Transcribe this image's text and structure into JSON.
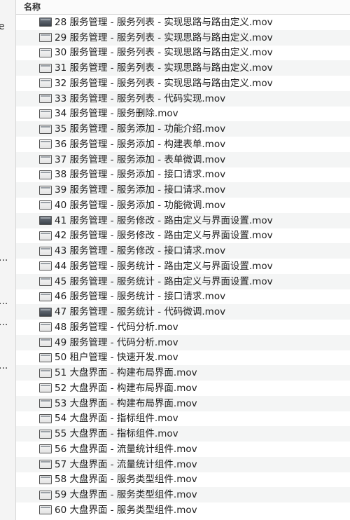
{
  "sidebar": {
    "fragments": [
      "e",
      "...",
      "...",
      "...",
      "..."
    ]
  },
  "header": {
    "name_column": "名称"
  },
  "files": [
    {
      "name": "28 服务管理 - 服务列表 - 实现思路与路由定义.mov",
      "icon": "video-file-icon",
      "thumb": "dark"
    },
    {
      "name": "29 服务管理 - 服务列表 - 实现思路与路由定义.mov",
      "icon": "video-file-icon",
      "thumb": "light"
    },
    {
      "name": "30 服务管理 - 服务列表 - 实现思路与路由定义.mov",
      "icon": "video-file-icon",
      "thumb": "light"
    },
    {
      "name": "31 服务管理 - 服务列表 - 实现思路与路由定义.mov",
      "icon": "video-file-icon",
      "thumb": "light"
    },
    {
      "name": "32 服务管理 - 服务列表 - 实现思路与路由定义.mov",
      "icon": "video-file-icon",
      "thumb": "light"
    },
    {
      "name": "33 服务管理 - 服务列表 - 代码实现.mov",
      "icon": "video-file-icon",
      "thumb": "light"
    },
    {
      "name": "34 服务管理 - 服务删除.mov",
      "icon": "video-file-icon",
      "thumb": "light"
    },
    {
      "name": "35 服务管理 - 服务添加 - 功能介绍.mov",
      "icon": "video-file-icon",
      "thumb": "light"
    },
    {
      "name": "36 服务管理 - 服务添加 - 构建表单.mov",
      "icon": "video-file-icon",
      "thumb": "light"
    },
    {
      "name": "37 服务管理 - 服务添加 - 表单微调.mov",
      "icon": "video-file-icon",
      "thumb": "light"
    },
    {
      "name": "38 服务管理 - 服务添加 - 接口请求.mov",
      "icon": "video-file-icon",
      "thumb": "light"
    },
    {
      "name": "39 服务管理 - 服务添加 - 接口请求.mov",
      "icon": "video-file-icon",
      "thumb": "light"
    },
    {
      "name": "40 服务管理 - 服务添加 - 功能微调.mov",
      "icon": "video-file-icon",
      "thumb": "light"
    },
    {
      "name": "41 服务管理 - 服务修改 - 路由定义与界面设置.mov",
      "icon": "video-file-icon",
      "thumb": "dark"
    },
    {
      "name": "42 服务管理 - 服务修改 - 路由定义与界面设置.mov",
      "icon": "video-file-icon",
      "thumb": "light"
    },
    {
      "name": "43 服务管理 - 服务修改 - 接口请求.mov",
      "icon": "video-file-icon",
      "thumb": "light"
    },
    {
      "name": "44 服务管理 - 服务统计 - 路由定义与界面设置.mov",
      "icon": "video-file-icon",
      "thumb": "light"
    },
    {
      "name": "45 服务管理 - 服务统计 - 路由定义与界面设置.mov",
      "icon": "video-file-icon",
      "thumb": "light"
    },
    {
      "name": "46 服务管理 - 服务统计 - 接口请求.mov",
      "icon": "video-file-icon",
      "thumb": "light"
    },
    {
      "name": "47 服务管理 - 服务统计 - 代码微调.mov",
      "icon": "video-file-icon",
      "thumb": "dark"
    },
    {
      "name": "48 服务管理 - 代码分析.mov",
      "icon": "video-file-icon",
      "thumb": "light"
    },
    {
      "name": "49 服务管理 - 代码分析.mov",
      "icon": "video-file-icon",
      "thumb": "light"
    },
    {
      "name": "50 租户管理 - 快速开发.mov",
      "icon": "video-file-icon",
      "thumb": "light"
    },
    {
      "name": "51 大盘界面 - 构建布局界面.mov",
      "icon": "video-file-icon",
      "thumb": "light"
    },
    {
      "name": "52 大盘界面 - 构建布局界面.mov",
      "icon": "video-file-icon",
      "thumb": "light"
    },
    {
      "name": "53 大盘界面 - 构建布局界面.mov",
      "icon": "video-file-icon",
      "thumb": "light"
    },
    {
      "name": "54 大盘界面 - 指标组件.mov",
      "icon": "video-file-icon",
      "thumb": "light"
    },
    {
      "name": "55 大盘界面 - 指标组件.mov",
      "icon": "video-file-icon",
      "thumb": "light"
    },
    {
      "name": "56 大盘界面 - 流量统计组件.mov",
      "icon": "video-file-icon",
      "thumb": "light"
    },
    {
      "name": "57 大盘界面 - 流量统计组件.mov",
      "icon": "video-file-icon",
      "thumb": "light"
    },
    {
      "name": "58 大盘界面 - 服务类型组件.mov",
      "icon": "video-file-icon",
      "thumb": "light"
    },
    {
      "name": "59 大盘界面 - 服务类型组件.mov",
      "icon": "video-file-icon",
      "thumb": "light"
    },
    {
      "name": "60 大盘界面 - 服务类型组件.mov",
      "icon": "video-file-icon",
      "thumb": "light"
    }
  ]
}
